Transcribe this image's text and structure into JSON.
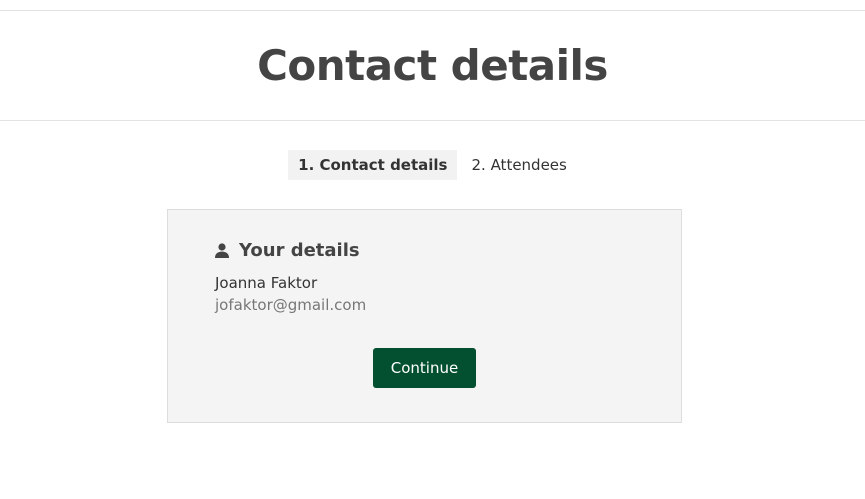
{
  "header": {
    "title": "Contact details"
  },
  "steps": [
    {
      "label": "1. Contact details",
      "active": true
    },
    {
      "label": "2. Attendees",
      "active": false
    }
  ],
  "details": {
    "icon": "user-icon",
    "heading": "Your details",
    "name": "Joanna Faktor",
    "email": "jofaktor@gmail.com",
    "continue_label": "Continue"
  },
  "colors": {
    "button_bg": "#035031",
    "card_bg": "#f4f4f4",
    "active_step_bg": "#f2f2f2",
    "email_text": "#777777"
  }
}
